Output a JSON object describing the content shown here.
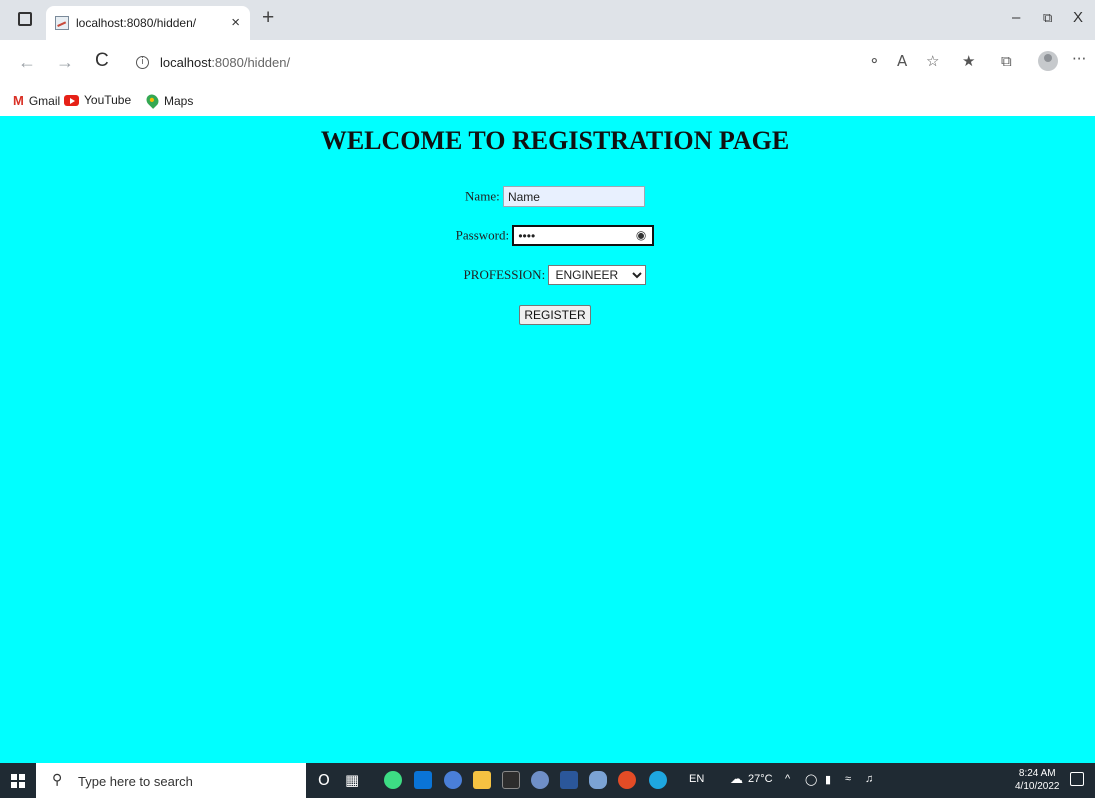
{
  "browser": {
    "tab_title": "localhost:8080/hidden/",
    "tab_close": "×",
    "new_tab": "+",
    "url_host": "localhost",
    "url_path": ":8080/hidden/",
    "bookmarks": [
      {
        "label": "Gmail",
        "icon": "gmail-icon"
      },
      {
        "label": "YouTube",
        "icon": "youtube-icon"
      },
      {
        "label": "Maps",
        "icon": "maps-icon"
      }
    ],
    "menu_dots": "···"
  },
  "page": {
    "background": "#00ffff",
    "title": "WELCOME TO REGISTRATION PAGE",
    "name_label": "Name:",
    "name_value": "Name",
    "password_label": "Password:",
    "password_value": "••••",
    "profession_label": "PROFESSION:",
    "profession_selected": "ENGINEER",
    "register_label": "REGISTER"
  },
  "taskbar": {
    "search_placeholder": "Type here to search",
    "language": "EN",
    "temperature": "27°C",
    "time": "8:24 AM",
    "date": "4/10/2022"
  }
}
